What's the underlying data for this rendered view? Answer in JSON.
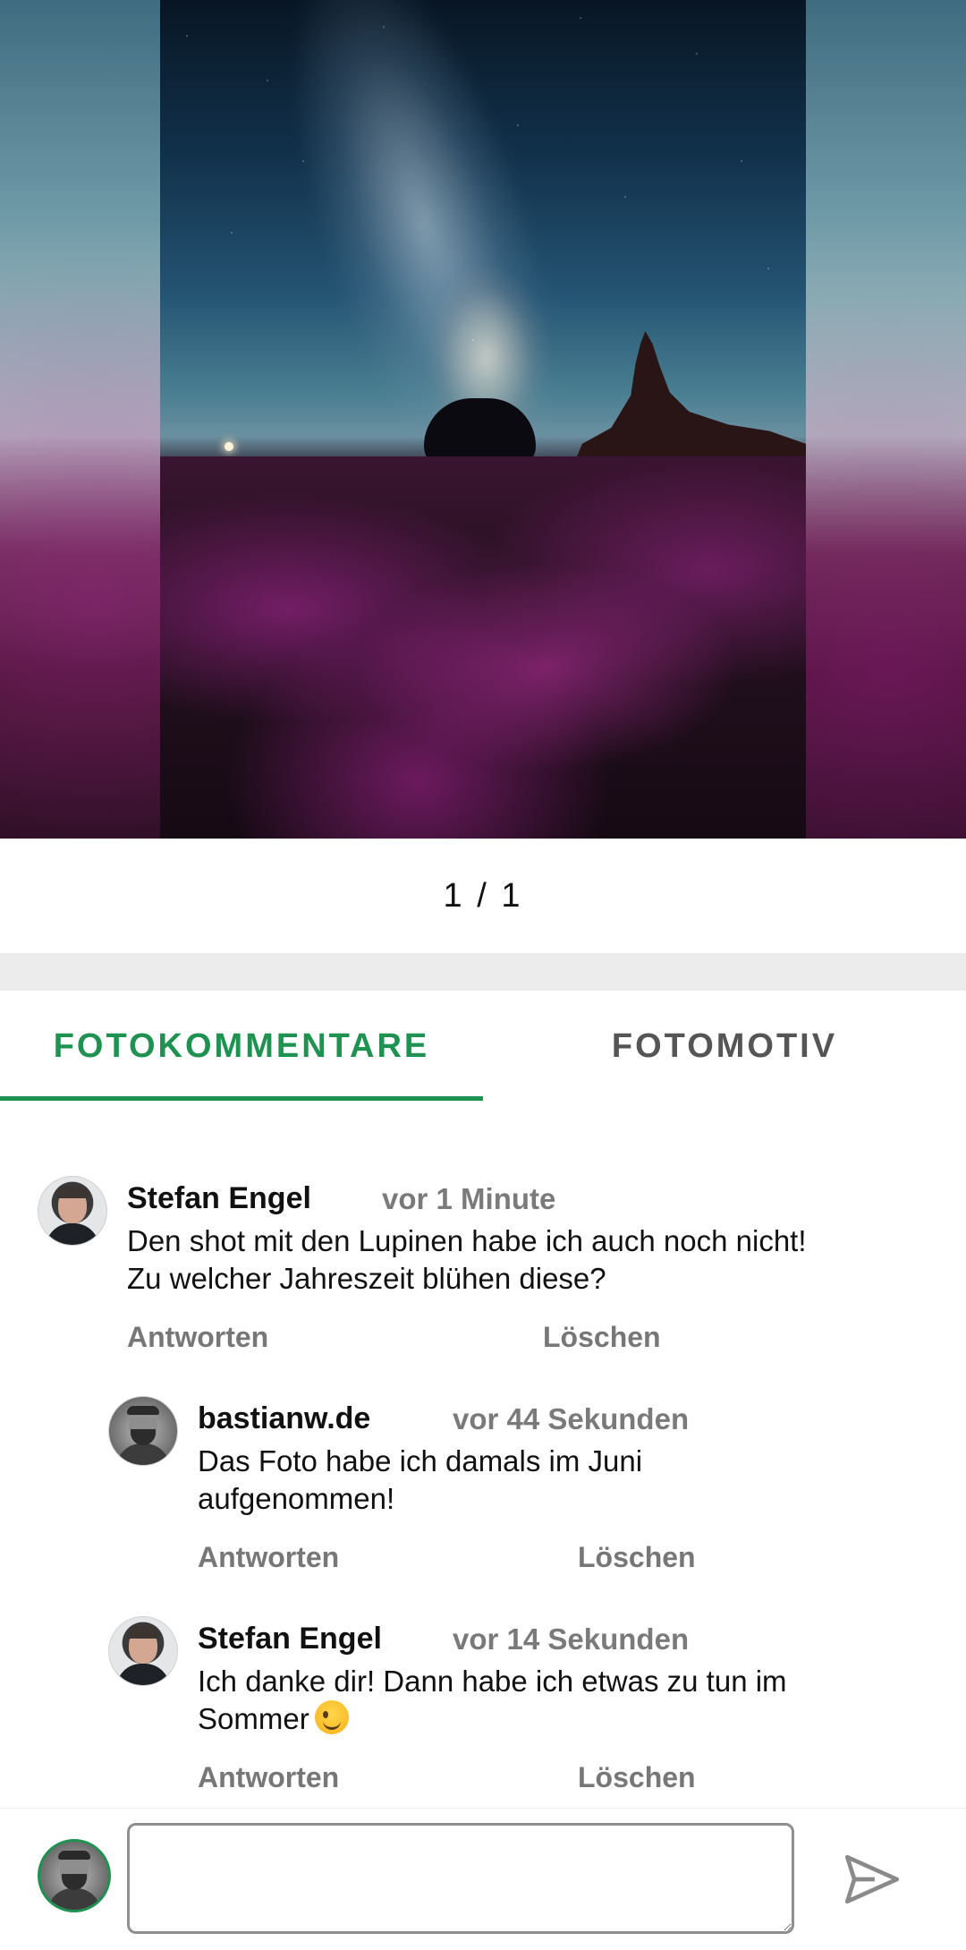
{
  "pager": {
    "text": "1 / 1"
  },
  "tabs": [
    {
      "label": "FOTOKOMMENTARE",
      "active": true
    },
    {
      "label": "FOTOMOTIV",
      "active": false
    }
  ],
  "comments": [
    {
      "name": "Stefan Engel",
      "time": "vor 1 Minute",
      "text_lines": [
        "Den shot mit den Lupinen habe ich auch noch nicht!",
        "Zu welcher Jahreszeit blühen diese?"
      ],
      "reply_label": "Antworten",
      "delete_label": "Löschen"
    },
    {
      "name": "bastianw.de",
      "time": "vor 44 Sekunden",
      "text_lines": [
        "Das Foto habe ich damals im Juni",
        "aufgenommen!"
      ],
      "reply_label": "Antworten",
      "delete_label": "Löschen"
    },
    {
      "name": "Stefan Engel",
      "time": "vor 14 Sekunden",
      "text_lines": [
        "Ich danke dir! Dann habe ich etwas zu tun im",
        "Sommer"
      ],
      "emoji": "winking-face",
      "reply_label": "Antworten",
      "delete_label": "Löschen"
    }
  ],
  "compose": {
    "value": "",
    "placeholder": "",
    "send_icon": "send-icon"
  },
  "colors": {
    "accent": "#1f9150",
    "muted": "#7a7a7a",
    "band": "#ececec"
  }
}
